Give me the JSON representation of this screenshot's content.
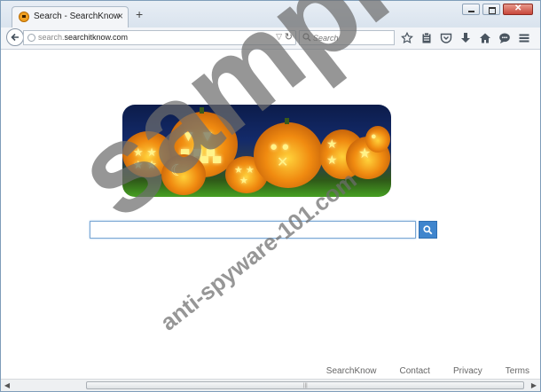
{
  "browser": {
    "tab": {
      "title": "Search - SearchKnow",
      "favicon": "pumpkin-icon"
    },
    "new_tab_label": "+",
    "window_controls": [
      "minimize-icon",
      "maximize-icon",
      "close-icon"
    ],
    "url": {
      "prefix": "search.",
      "domain": "searchitknow.com"
    },
    "search": {
      "placeholder": "Search"
    },
    "toolbar_icons": [
      "star-icon",
      "clipboard-icon",
      "pocket-icon",
      "download-icon",
      "home-icon",
      "chat-icon",
      "menu-icon"
    ]
  },
  "page": {
    "banner": {
      "theme": "halloween-pumpkins"
    },
    "search_input": {
      "value": "",
      "placeholder": ""
    },
    "search_button_icon": "search-icon",
    "footer_links": [
      "SearchKnow",
      "Contact",
      "Privacy",
      "Terms"
    ]
  },
  "watermark": {
    "big": "sample",
    "small": "anti-spyware-101.com"
  },
  "colors": {
    "accent": "#3f85cd",
    "footer_text": "#666666"
  }
}
